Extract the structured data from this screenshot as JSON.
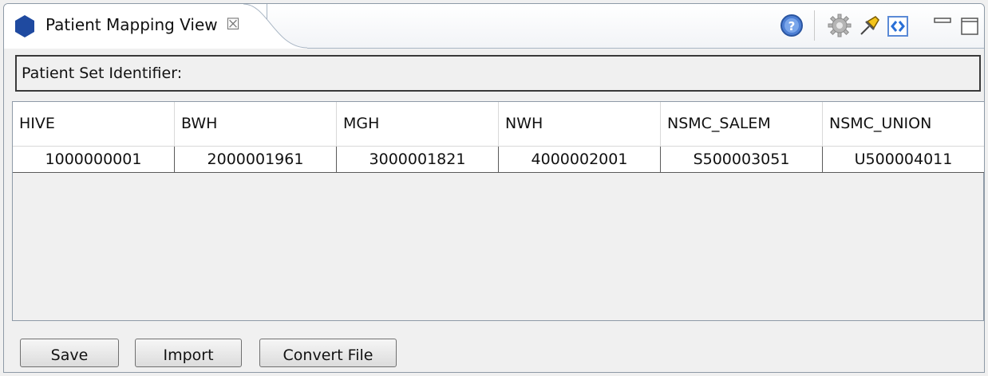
{
  "tab": {
    "title": "Patient Mapping View",
    "close_glyph": "☒",
    "icon": "hexagon-icon",
    "icon_color": "#1f4aa0"
  },
  "toolbar": {
    "icons": [
      "help-icon",
      "gear-icon",
      "pin-icon",
      "link-icon",
      "minimize-icon",
      "maximize-icon"
    ]
  },
  "patient_set": {
    "label": "Patient Set Identifier:"
  },
  "table": {
    "columns": [
      "HIVE",
      "BWH",
      "MGH",
      "NWH",
      "NSMC_SALEM",
      "NSMC_UNION"
    ],
    "rows": [
      [
        "1000000001",
        "2000001961",
        "3000001821",
        "4000002001",
        "S500003051",
        "U500004011"
      ]
    ]
  },
  "buttons": {
    "save": "Save",
    "import": "Import",
    "convert": "Convert File"
  }
}
